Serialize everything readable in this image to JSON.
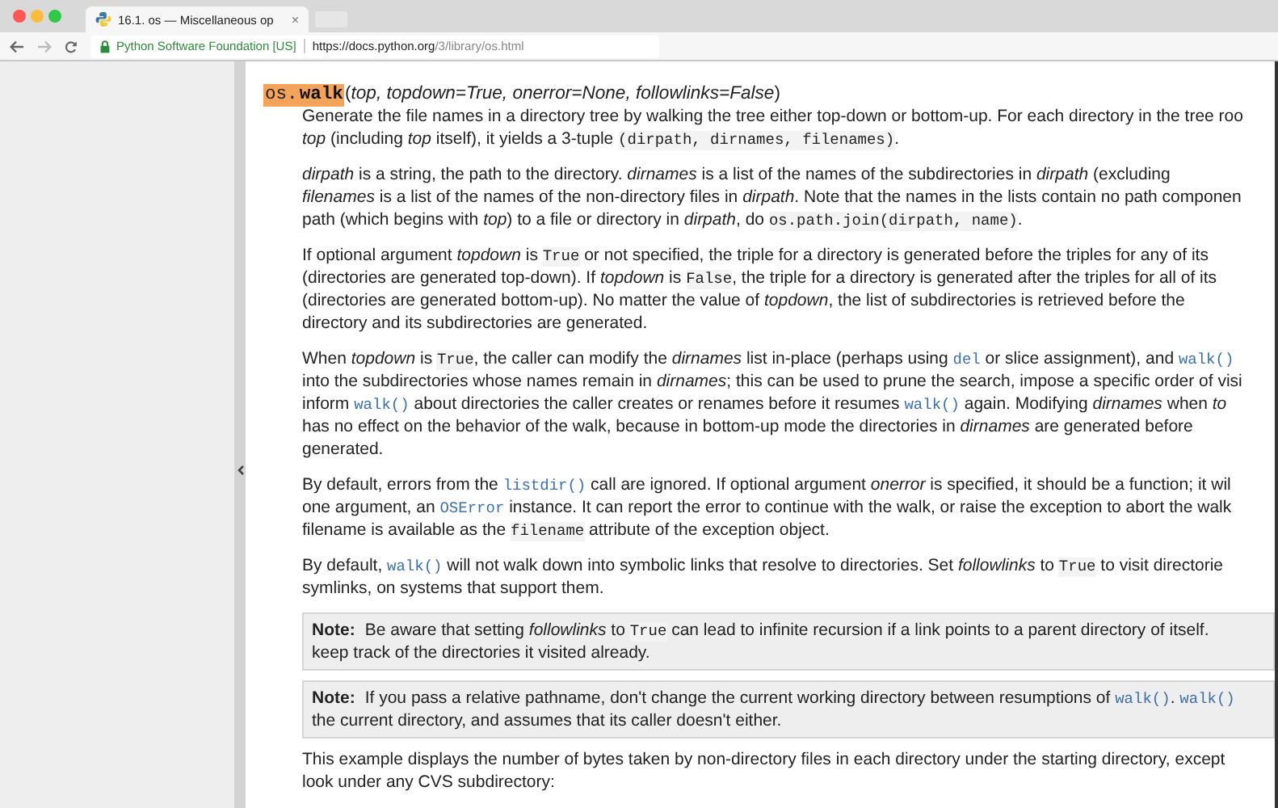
{
  "browser": {
    "tab": {
      "title": "16.1. os — Miscellaneous op",
      "close": "×"
    },
    "address": {
      "site_identity": "Python Software Foundation [US]",
      "url_host": "https://docs.python.org",
      "url_path": "/3/library/os.html"
    }
  },
  "doc": {
    "signature": [
      {
        "kind": "module",
        "text": "os."
      },
      {
        "kind": "name",
        "text": "walk"
      },
      {
        "kind": "text",
        "text": "("
      },
      {
        "kind": "em",
        "text": "top, topdown=True, onerror=None, followlinks=False"
      },
      {
        "kind": "text",
        "text": ")"
      }
    ],
    "blocks": [
      {
        "kind": "paragraph",
        "lines": [
          [
            {
              "kind": "text",
              "text": "Generate the file names in a directory tree by walking the tree either top-down or bottom-up. For each directory in the tree roo"
            }
          ],
          [
            {
              "kind": "em",
              "text": "top"
            },
            {
              "kind": "text",
              "text": " (including "
            },
            {
              "kind": "em",
              "text": "top"
            },
            {
              "kind": "text",
              "text": " itself), it yields a 3-tuple "
            },
            {
              "kind": "code",
              "text": "(dirpath, dirnames, filenames)"
            },
            {
              "kind": "text",
              "text": "."
            }
          ]
        ]
      },
      {
        "kind": "paragraph",
        "lines": [
          [
            {
              "kind": "em",
              "text": "dirpath"
            },
            {
              "kind": "text",
              "text": " is a string, the path to the directory. "
            },
            {
              "kind": "em",
              "text": "dirnames"
            },
            {
              "kind": "text",
              "text": " is a list of the names of the subdirectories in "
            },
            {
              "kind": "em",
              "text": "dirpath"
            },
            {
              "kind": "text",
              "text": " (excluding"
            }
          ],
          [
            {
              "kind": "em",
              "text": "filenames"
            },
            {
              "kind": "text",
              "text": " is a list of the names of the non-directory files in "
            },
            {
              "kind": "em",
              "text": "dirpath"
            },
            {
              "kind": "text",
              "text": ". Note that the names in the lists contain no path componen"
            }
          ],
          [
            {
              "kind": "text",
              "text": "path (which begins with "
            },
            {
              "kind": "em",
              "text": "top"
            },
            {
              "kind": "text",
              "text": ") to a file or directory in "
            },
            {
              "kind": "em",
              "text": "dirpath"
            },
            {
              "kind": "text",
              "text": ", do "
            },
            {
              "kind": "code",
              "text": "os.path.join(dirpath, name)"
            },
            {
              "kind": "text",
              "text": "."
            }
          ]
        ]
      },
      {
        "kind": "paragraph",
        "lines": [
          [
            {
              "kind": "text",
              "text": "If optional argument "
            },
            {
              "kind": "em",
              "text": "topdown"
            },
            {
              "kind": "text",
              "text": " is "
            },
            {
              "kind": "code",
              "text": "True"
            },
            {
              "kind": "text",
              "text": " or not specified, the triple for a directory is generated before the triples for any of its"
            }
          ],
          [
            {
              "kind": "text",
              "text": "(directories are generated top-down). If "
            },
            {
              "kind": "em",
              "text": "topdown"
            },
            {
              "kind": "text",
              "text": " is "
            },
            {
              "kind": "code",
              "text": "False"
            },
            {
              "kind": "text",
              "text": ", the triple for a directory is generated after the triples for all of its"
            }
          ],
          [
            {
              "kind": "text",
              "text": "(directories are generated bottom-up). No matter the value of "
            },
            {
              "kind": "em",
              "text": "topdown"
            },
            {
              "kind": "text",
              "text": ", the list of subdirectories is retrieved before the"
            }
          ],
          [
            {
              "kind": "text",
              "text": "directory and its subdirectories are generated."
            }
          ]
        ]
      },
      {
        "kind": "paragraph",
        "lines": [
          [
            {
              "kind": "text",
              "text": "When "
            },
            {
              "kind": "em",
              "text": "topdown"
            },
            {
              "kind": "text",
              "text": " is "
            },
            {
              "kind": "code",
              "text": "True"
            },
            {
              "kind": "text",
              "text": ", the caller can modify the "
            },
            {
              "kind": "em",
              "text": "dirnames"
            },
            {
              "kind": "text",
              "text": " list in-place (perhaps using "
            },
            {
              "kind": "link",
              "text": "del"
            },
            {
              "kind": "text",
              "text": " or slice assignment), and "
            },
            {
              "kind": "link",
              "text": "walk()"
            }
          ],
          [
            {
              "kind": "text",
              "text": "into the subdirectories whose names remain in "
            },
            {
              "kind": "em",
              "text": "dirnames"
            },
            {
              "kind": "text",
              "text": "; this can be used to prune the search, impose a specific order of visi"
            }
          ],
          [
            {
              "kind": "text",
              "text": "inform "
            },
            {
              "kind": "link",
              "text": "walk()"
            },
            {
              "kind": "text",
              "text": " about directories the caller creates or renames before it resumes "
            },
            {
              "kind": "link",
              "text": "walk()"
            },
            {
              "kind": "text",
              "text": " again. Modifying "
            },
            {
              "kind": "em",
              "text": "dirnames"
            },
            {
              "kind": "text",
              "text": " when "
            },
            {
              "kind": "em",
              "text": "to"
            }
          ],
          [
            {
              "kind": "text",
              "text": "has no effect on the behavior of the walk, because in bottom-up mode the directories in "
            },
            {
              "kind": "em",
              "text": "dirnames"
            },
            {
              "kind": "text",
              "text": " are generated before"
            }
          ],
          [
            {
              "kind": "text",
              "text": "generated."
            }
          ]
        ]
      },
      {
        "kind": "paragraph",
        "lines": [
          [
            {
              "kind": "text",
              "text": "By default, errors from the "
            },
            {
              "kind": "link",
              "text": "listdir()"
            },
            {
              "kind": "text",
              "text": " call are ignored. If optional argument "
            },
            {
              "kind": "em",
              "text": "onerror"
            },
            {
              "kind": "text",
              "text": " is specified, it should be a function; it wil"
            }
          ],
          [
            {
              "kind": "text",
              "text": "one argument, an "
            },
            {
              "kind": "link",
              "text": "OSError"
            },
            {
              "kind": "text",
              "text": " instance. It can report the error to continue with the walk, or raise the exception to abort the walk"
            }
          ],
          [
            {
              "kind": "text",
              "text": "filename is available as the "
            },
            {
              "kind": "code",
              "text": "filename"
            },
            {
              "kind": "text",
              "text": " attribute of the exception object."
            }
          ]
        ]
      },
      {
        "kind": "paragraph",
        "lines": [
          [
            {
              "kind": "text",
              "text": "By default, "
            },
            {
              "kind": "link",
              "text": "walk()"
            },
            {
              "kind": "text",
              "text": " will not walk down into symbolic links that resolve to directories. Set "
            },
            {
              "kind": "em",
              "text": "followlinks"
            },
            {
              "kind": "text",
              "text": " to "
            },
            {
              "kind": "code",
              "text": "True"
            },
            {
              "kind": "text",
              "text": " to visit directorie"
            }
          ],
          [
            {
              "kind": "text",
              "text": "symlinks, on systems that support them."
            }
          ]
        ]
      },
      {
        "kind": "note",
        "label": "Note:",
        "lines": [
          [
            {
              "kind": "text",
              "text": "Be aware that setting "
            },
            {
              "kind": "em",
              "text": "followlinks"
            },
            {
              "kind": "text",
              "text": " to "
            },
            {
              "kind": "code",
              "text": "True"
            },
            {
              "kind": "text",
              "text": " can lead to infinite recursion if a link points to a parent directory of itself."
            }
          ],
          [
            {
              "kind": "text",
              "text": "keep track of the directories it visited already."
            }
          ]
        ]
      },
      {
        "kind": "note",
        "label": "Note:",
        "lines": [
          [
            {
              "kind": "text",
              "text": "If you pass a relative pathname, don't change the current working directory between resumptions of "
            },
            {
              "kind": "link",
              "text": "walk()"
            },
            {
              "kind": "text",
              "text": ". "
            },
            {
              "kind": "link",
              "text": "walk()"
            }
          ],
          [
            {
              "kind": "text",
              "text": "the current directory, and assumes that its caller doesn't either."
            }
          ]
        ]
      },
      {
        "kind": "paragraph",
        "lines": [
          [
            {
              "kind": "text",
              "text": "This example displays the number of bytes taken by non-directory files in each directory under the starting directory, except"
            }
          ],
          [
            {
              "kind": "text",
              "text": "look under any CVS subdirectory:"
            }
          ]
        ]
      }
    ]
  }
}
